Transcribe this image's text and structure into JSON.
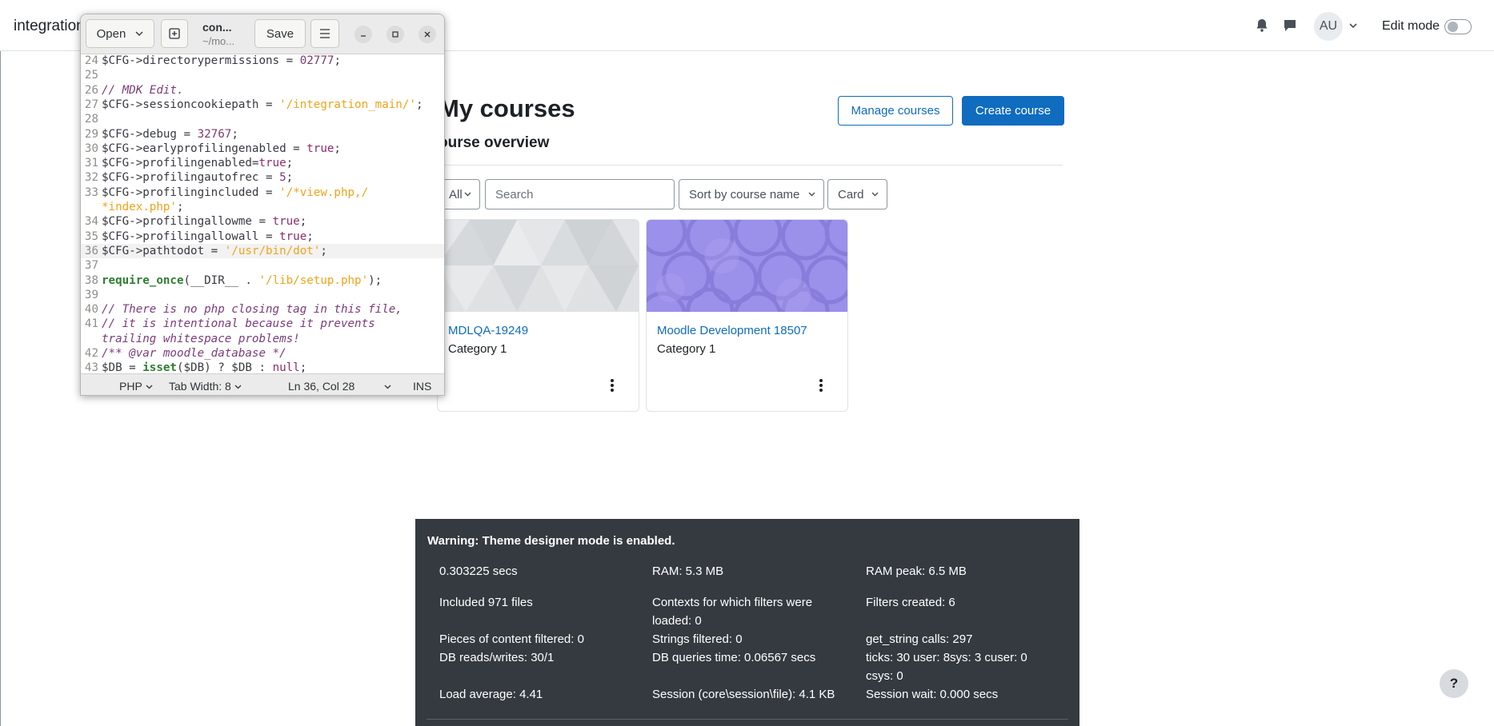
{
  "site": {
    "name": "integration",
    "edit_mode_label": "Edit mode",
    "edit_mode_on": false,
    "avatar_initials": "AU"
  },
  "page": {
    "title": "My courses",
    "manage_courses_label": "Manage courses",
    "create_course_label": "Create course",
    "section_title": "ourse overview",
    "filters": {
      "grouping": "All",
      "search_placeholder": "Search",
      "sort": "Sort by course name",
      "view": "Card"
    },
    "courses": [
      {
        "name": "MDLQA-19249",
        "category": "Category 1",
        "image_style": "gray-triangles"
      },
      {
        "name": "Moodle Development 18507",
        "category": "Category 1",
        "image_style": "purple-circles"
      }
    ]
  },
  "performance": {
    "warning": "Warning: Theme designer mode is enabled.",
    "items": {
      "secs": "0.303225 secs",
      "ram": "RAM: 5.3 MB",
      "ram_peak": "RAM peak: 6.5 MB",
      "included": "Included 971 files",
      "contexts_1": "Contexts for which filters were",
      "contexts_2": "loaded: 0",
      "filters_created": "Filters created: 6",
      "pieces": "Pieces of content filtered: 0",
      "strings": "Strings filtered: 0",
      "get_string": "get_string calls: 297",
      "db_rw": "DB reads/writes: 30/1",
      "db_time": "DB queries time: 0.06567 secs",
      "ticks_1": "ticks: 30 user: 8sys: 3 cuser: 0",
      "ticks_2": "csys: 0",
      "load": "Load average: 4.41",
      "session": "Session (core\\session\\file): 4.1 KB",
      "session_wait": "Session wait: 0.000 secs"
    }
  },
  "help_label": "?",
  "editor": {
    "open_label": "Open",
    "save_label": "Save",
    "title": "con...",
    "subtitle": "~/mo...",
    "status": {
      "language": "PHP",
      "tab_width": "Tab Width: 8",
      "position": "Ln 36, Col 28",
      "mode": "INS"
    },
    "lines": [
      {
        "n": "24",
        "t": "$CFG->directorypermissions = 02777;"
      },
      {
        "n": "25",
        "t": ""
      },
      {
        "n": "26",
        "t": "// MDK Edit."
      },
      {
        "n": "27",
        "t": "$CFG->sessioncookiepath = '/integration_main/';"
      },
      {
        "n": "28",
        "t": ""
      },
      {
        "n": "29",
        "t": "$CFG->debug = 32767;"
      },
      {
        "n": "30",
        "t": "$CFG->earlyprofilingenabled = true;"
      },
      {
        "n": "31",
        "t": "$CFG->profilingenabled=true;"
      },
      {
        "n": "32",
        "t": "$CFG->profilingautofrec = 5;"
      },
      {
        "n": "33",
        "t": "$CFG->profilingincluded = '/*view.php,/"
      },
      {
        "n": "",
        "t": "*index.php';"
      },
      {
        "n": "34",
        "t": "$CFG->profilingallowme = true;"
      },
      {
        "n": "35",
        "t": "$CFG->profilingallowall = true;"
      },
      {
        "n": "36",
        "t": "$CFG->pathtodot = '/usr/bin/dot';"
      },
      {
        "n": "37",
        "t": ""
      },
      {
        "n": "38",
        "t": "require_once(__DIR__ . '/lib/setup.php');"
      },
      {
        "n": "39",
        "t": ""
      },
      {
        "n": "40",
        "t": "// There is no php closing tag in this file,"
      },
      {
        "n": "41",
        "t": "// it is intentional because it prevents"
      },
      {
        "n": "",
        "t": "trailing whitespace problems!"
      },
      {
        "n": "42",
        "t": "/** @var moodle_database */"
      },
      {
        "n": "43",
        "t": "$DB = isset($DB) ? $DB : null;"
      }
    ]
  }
}
